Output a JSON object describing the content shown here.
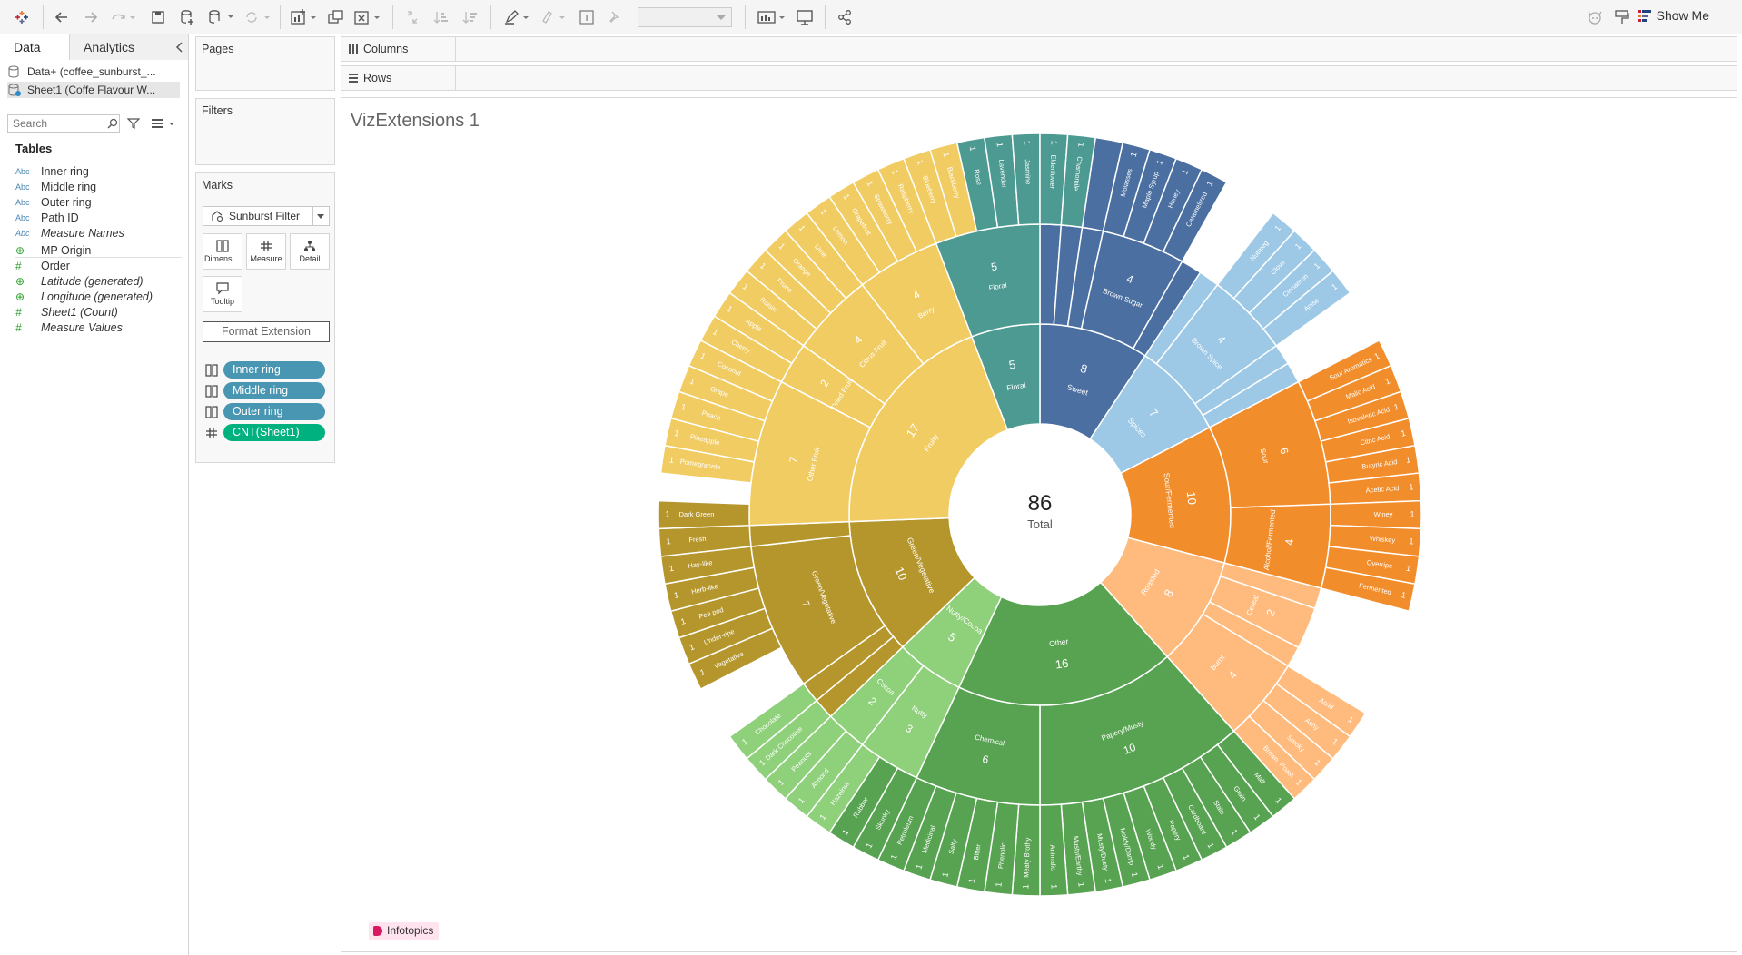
{
  "toolbar": {
    "show_me": "Show Me"
  },
  "datapane": {
    "tabs": [
      "Data",
      "Analytics"
    ],
    "sources": [
      "Data+ (coffee_sunburst_...",
      "Sheet1 (Coffe Flavour W..."
    ],
    "search_placeholder": "Search",
    "tables_heading": "Tables",
    "fields": [
      {
        "type": "Abc",
        "name": "Inner ring",
        "italic": false
      },
      {
        "type": "Abc",
        "name": "Middle ring",
        "italic": false
      },
      {
        "type": "Abc",
        "name": "Outer ring",
        "italic": false
      },
      {
        "type": "Abc",
        "name": "Path ID",
        "italic": false
      },
      {
        "type": "Abc",
        "name": "Measure Names",
        "italic": true
      },
      {
        "type": "geo",
        "name": "MP Origin",
        "italic": false
      },
      {
        "type": "#",
        "name": "Order",
        "italic": false
      },
      {
        "type": "geo",
        "name": "Latitude (generated)",
        "italic": true
      },
      {
        "type": "geo",
        "name": "Longitude (generated)",
        "italic": true
      },
      {
        "type": "#",
        "name": "Sheet1 (Count)",
        "italic": true
      },
      {
        "type": "#",
        "name": "Measure Values",
        "italic": true
      }
    ]
  },
  "cards": {
    "pages": "Pages",
    "filters": "Filters",
    "marks": "Marks",
    "mark_type": "Sunburst Filter",
    "mark_buttons": [
      "Dimensi...",
      "Measure",
      "Detail",
      "Tooltip"
    ],
    "format_extension": "Format Extension",
    "pills": [
      {
        "label": "Inner ring",
        "color": "#4996b2"
      },
      {
        "label": "Middle ring",
        "color": "#4996b2"
      },
      {
        "label": "Outer ring",
        "color": "#4996b2"
      },
      {
        "label": "CNT(Sheet1)",
        "color": "#00b180"
      }
    ]
  },
  "shelves": {
    "columns": "Columns",
    "rows": "Rows"
  },
  "viz": {
    "title": "VizExtensions 1",
    "brand": "Infotopics"
  },
  "chart_data": {
    "type": "sunburst",
    "center_value": "86",
    "center_label": "Total",
    "inner": [
      {
        "name": "Sweet",
        "value": 8,
        "color": "#4a6fa0"
      },
      {
        "name": "Spices",
        "value": 7,
        "color": "#9ec9e6"
      },
      {
        "name": "Sour/Fermented",
        "value": 10,
        "color": "#f28d2c"
      },
      {
        "name": "Roasted",
        "value": 8,
        "color": "#ffbb7d"
      },
      {
        "name": "Other",
        "value": 16,
        "color": "#58a352"
      },
      {
        "name": "Nutty/Cocoa",
        "value": 5,
        "color": "#8fd07a"
      },
      {
        "name": "Green/Vegetative",
        "value": 10,
        "color": "#b5962d"
      },
      {
        "name": "Fruity",
        "value": 17,
        "color": "#f1cc63"
      },
      {
        "name": "Floral",
        "value": 5,
        "color": "#4c9a91"
      }
    ],
    "middle": [
      {
        "inner": "Sweet",
        "name": "",
        "value": 1
      },
      {
        "inner": "Sweet",
        "name": "",
        "value": 1
      },
      {
        "inner": "Sweet",
        "name": "",
        "value": 1
      },
      {
        "inner": "Sweet",
        "name": "Brown Sugar",
        "value": 4
      },
      {
        "inner": "Sweet",
        "name": "",
        "value": 1
      },
      {
        "inner": "Spices",
        "name": "",
        "value": 1
      },
      {
        "inner": "Spices",
        "name": "Brown Spice",
        "value": 4
      },
      {
        "inner": "Spices",
        "name": "",
        "value": 1
      },
      {
        "inner": "Spices",
        "name": "",
        "value": 1
      },
      {
        "inner": "Sour/Fermented",
        "name": "Sour",
        "value": 6
      },
      {
        "inner": "Sour/Fermented",
        "name": "Alcohol/Fermented",
        "value": 4
      },
      {
        "inner": "Roasted",
        "name": "",
        "value": 1
      },
      {
        "inner": "Roasted",
        "name": "Cereal",
        "value": 2
      },
      {
        "inner": "Roasted",
        "name": "",
        "value": 1
      },
      {
        "inner": "Roasted",
        "name": "Burnt",
        "value": 4
      },
      {
        "inner": "Other",
        "name": "Papery/Musty",
        "value": 10
      },
      {
        "inner": "Other",
        "name": "Chemical",
        "value": 6
      },
      {
        "inner": "Nutty/Cocoa",
        "name": "Nutty",
        "value": 3
      },
      {
        "inner": "Nutty/Cocoa",
        "name": "Cocoa",
        "value": 2
      },
      {
        "inner": "Green/Vegetative",
        "name": "",
        "value": 1
      },
      {
        "inner": "Green/Vegetative",
        "name": "",
        "value": 1
      },
      {
        "inner": "Green/Vegetative",
        "name": "Green/Vegetative",
        "value": 7
      },
      {
        "inner": "Green/Vegetative",
        "name": "",
        "value": 1
      },
      {
        "inner": "Fruity",
        "name": "Other Fruit",
        "value": 7
      },
      {
        "inner": "Fruity",
        "name": "Dried Fruit",
        "value": 2
      },
      {
        "inner": "Fruity",
        "name": "Citrus Fruit",
        "value": 4
      },
      {
        "inner": "Fruity",
        "name": "Berry",
        "value": 4
      },
      {
        "inner": "Floral",
        "name": "Floral",
        "value": 5
      }
    ],
    "outer": [
      {
        "inner": "Sweet",
        "name": "",
        "value": 1,
        "gap": false
      },
      {
        "inner": "Sweet",
        "name": "",
        "value": 1,
        "gap": false
      },
      {
        "inner": "Sweet",
        "name": "",
        "value": 1,
        "gap": false
      },
      {
        "inner": "Sweet",
        "name": "Molasses",
        "value": 1,
        "gap": false
      },
      {
        "inner": "Sweet",
        "name": "Maple Syrup",
        "value": 1,
        "gap": false
      },
      {
        "inner": "Sweet",
        "name": "Honey",
        "value": 1,
        "gap": false
      },
      {
        "inner": "Sweet",
        "name": "Caramelized",
        "value": 1,
        "gap": false
      },
      {
        "inner": "Sweet",
        "name": "",
        "value": 1,
        "gap": true
      },
      {
        "inner": "Spices",
        "name": "",
        "value": 1,
        "gap": true
      },
      {
        "inner": "Spices",
        "name": "Nutmeg",
        "value": 1,
        "gap": false
      },
      {
        "inner": "Spices",
        "name": "Clove",
        "value": 1,
        "gap": false
      },
      {
        "inner": "Spices",
        "name": "Cinnamon",
        "value": 1,
        "gap": false
      },
      {
        "inner": "Spices",
        "name": "Anise",
        "value": 1,
        "gap": false
      },
      {
        "inner": "Spices",
        "name": "",
        "value": 1,
        "gap": true
      },
      {
        "inner": "Spices",
        "name": "",
        "value": 1,
        "gap": true
      },
      {
        "inner": "Sour/Fermented",
        "name": "Sour Aromatics",
        "value": 1,
        "gap": false
      },
      {
        "inner": "Sour/Fermented",
        "name": "Malic Acid",
        "value": 1,
        "gap": false
      },
      {
        "inner": "Sour/Fermented",
        "name": "Isovaleric Acid",
        "value": 1,
        "gap": false
      },
      {
        "inner": "Sour/Fermented",
        "name": "Citric Acid",
        "value": 1,
        "gap": false
      },
      {
        "inner": "Sour/Fermented",
        "name": "Butyric Acid",
        "value": 1,
        "gap": false
      },
      {
        "inner": "Sour/Fermented",
        "name": "Acetic Acid",
        "value": 1,
        "gap": false
      },
      {
        "inner": "Sour/Fermented",
        "name": "Winey",
        "value": 1,
        "gap": false
      },
      {
        "inner": "Sour/Fermented",
        "name": "Whiskey",
        "value": 1,
        "gap": false
      },
      {
        "inner": "Sour/Fermented",
        "name": "Overripe",
        "value": 1,
        "gap": false
      },
      {
        "inner": "Sour/Fermented",
        "name": "Fermented",
        "value": 1,
        "gap": false
      },
      {
        "inner": "Roasted",
        "name": "",
        "value": 1,
        "gap": true
      },
      {
        "inner": "Roasted",
        "name": "",
        "value": 1,
        "gap": true
      },
      {
        "inner": "Roasted",
        "name": "",
        "value": 1,
        "gap": true
      },
      {
        "inner": "Roasted",
        "name": "",
        "value": 1,
        "gap": true
      },
      {
        "inner": "Roasted",
        "name": "Acrid",
        "value": 1,
        "gap": false
      },
      {
        "inner": "Roasted",
        "name": "Ashy",
        "value": 1,
        "gap": false
      },
      {
        "inner": "Roasted",
        "name": "Smoky",
        "value": 1,
        "gap": false
      },
      {
        "inner": "Roasted",
        "name": "Brown, Roast",
        "value": 1,
        "gap": false
      },
      {
        "inner": "Other",
        "name": "Malt",
        "value": 1,
        "gap": false
      },
      {
        "inner": "Other",
        "name": "Grain",
        "value": 1,
        "gap": false
      },
      {
        "inner": "Other",
        "name": "Stale",
        "value": 1,
        "gap": false
      },
      {
        "inner": "Other",
        "name": "Cardboard",
        "value": 1,
        "gap": false
      },
      {
        "inner": "Other",
        "name": "Papery",
        "value": 1,
        "gap": false
      },
      {
        "inner": "Other",
        "name": "Woody",
        "value": 1,
        "gap": false
      },
      {
        "inner": "Other",
        "name": "Moldy/Damp",
        "value": 1,
        "gap": false
      },
      {
        "inner": "Other",
        "name": "Musty/Dusty",
        "value": 1,
        "gap": false
      },
      {
        "inner": "Other",
        "name": "Musty/Earthy",
        "value": 1,
        "gap": false
      },
      {
        "inner": "Other",
        "name": "Animalic",
        "value": 1,
        "gap": false
      },
      {
        "inner": "Other",
        "name": "Meaty Brothy",
        "value": 1,
        "gap": false
      },
      {
        "inner": "Other",
        "name": "Phenolic",
        "value": 1,
        "gap": false
      },
      {
        "inner": "Other",
        "name": "Bitter",
        "value": 1,
        "gap": false
      },
      {
        "inner": "Other",
        "name": "Salty",
        "value": 1,
        "gap": false
      },
      {
        "inner": "Other",
        "name": "Medicinal",
        "value": 1,
        "gap": false
      },
      {
        "inner": "Other",
        "name": "Petroleum",
        "value": 1,
        "gap": false
      },
      {
        "inner": "Other",
        "name": "Skunky",
        "value": 1,
        "gap": false
      },
      {
        "inner": "Other",
        "name": "Rubber",
        "value": 1,
        "gap": false
      },
      {
        "inner": "Nutty/Cocoa",
        "name": "Hazelnut",
        "value": 1,
        "gap": false
      },
      {
        "inner": "Nutty/Cocoa",
        "name": "Almond",
        "value": 1,
        "gap": false
      },
      {
        "inner": "Nutty/Cocoa",
        "name": "Peanuts",
        "value": 1,
        "gap": false
      },
      {
        "inner": "Nutty/Cocoa",
        "name": "Dark Chocolate",
        "value": 1,
        "gap": false
      },
      {
        "inner": "Nutty/Cocoa",
        "name": "Chocolate",
        "value": 1,
        "gap": false
      },
      {
        "inner": "Green/Vegetative",
        "name": "",
        "value": 1,
        "gap": true
      },
      {
        "inner": "Green/Vegetative",
        "name": "",
        "value": 1,
        "gap": true
      },
      {
        "inner": "Green/Vegetative",
        "name": "Vegetative",
        "value": 1,
        "gap": false
      },
      {
        "inner": "Green/Vegetative",
        "name": "Under-ripe",
        "value": 1,
        "gap": false
      },
      {
        "inner": "Green/Vegetative",
        "name": "Pea pod",
        "value": 1,
        "gap": false
      },
      {
        "inner": "Green/Vegetative",
        "name": "Herb-like",
        "value": 1,
        "gap": false
      },
      {
        "inner": "Green/Vegetative",
        "name": "Hay-like",
        "value": 1,
        "gap": false
      },
      {
        "inner": "Green/Vegetative",
        "name": "Fresh",
        "value": 1,
        "gap": false
      },
      {
        "inner": "Green/Vegetative",
        "name": "Dark Green",
        "value": 1,
        "gap": false
      },
      {
        "inner": "Green/Vegetative",
        "name": "",
        "value": 1,
        "gap": true
      },
      {
        "inner": "Fruity",
        "name": "Pomegranate",
        "value": 1,
        "gap": false
      },
      {
        "inner": "Fruity",
        "name": "Pineapple",
        "value": 1,
        "gap": false
      },
      {
        "inner": "Fruity",
        "name": "Peach",
        "value": 1,
        "gap": false
      },
      {
        "inner": "Fruity",
        "name": "Grape",
        "value": 1,
        "gap": false
      },
      {
        "inner": "Fruity",
        "name": "Coconut",
        "value": 1,
        "gap": false
      },
      {
        "inner": "Fruity",
        "name": "Cherry",
        "value": 1,
        "gap": false
      },
      {
        "inner": "Fruity",
        "name": "Apple",
        "value": 1,
        "gap": false
      },
      {
        "inner": "Fruity",
        "name": "Raisin",
        "value": 1,
        "gap": false
      },
      {
        "inner": "Fruity",
        "name": "Prune",
        "value": 1,
        "gap": false
      },
      {
        "inner": "Fruity",
        "name": "Orange",
        "value": 1,
        "gap": false
      },
      {
        "inner": "Fruity",
        "name": "Lime",
        "value": 1,
        "gap": false
      },
      {
        "inner": "Fruity",
        "name": "Lemon",
        "value": 1,
        "gap": false
      },
      {
        "inner": "Fruity",
        "name": "Grapefruit",
        "value": 1,
        "gap": false
      },
      {
        "inner": "Fruity",
        "name": "Strawberry",
        "value": 1,
        "gap": false
      },
      {
        "inner": "Fruity",
        "name": "Raspberry",
        "value": 1,
        "gap": false
      },
      {
        "inner": "Fruity",
        "name": "Blueberry",
        "value": 1,
        "gap": false
      },
      {
        "inner": "Fruity",
        "name": "Blackberry",
        "value": 1,
        "gap": false
      },
      {
        "inner": "Floral",
        "name": "Rose",
        "value": 1,
        "gap": false
      },
      {
        "inner": "Floral",
        "name": "Lavender",
        "value": 1,
        "gap": false
      },
      {
        "inner": "Floral",
        "name": "Jasmine",
        "value": 1,
        "gap": false
      },
      {
        "inner": "Floral",
        "name": "Elderflower",
        "value": 1,
        "gap": false
      },
      {
        "inner": "Floral",
        "name": "Chamomile",
        "value": 1,
        "gap": false
      }
    ]
  }
}
